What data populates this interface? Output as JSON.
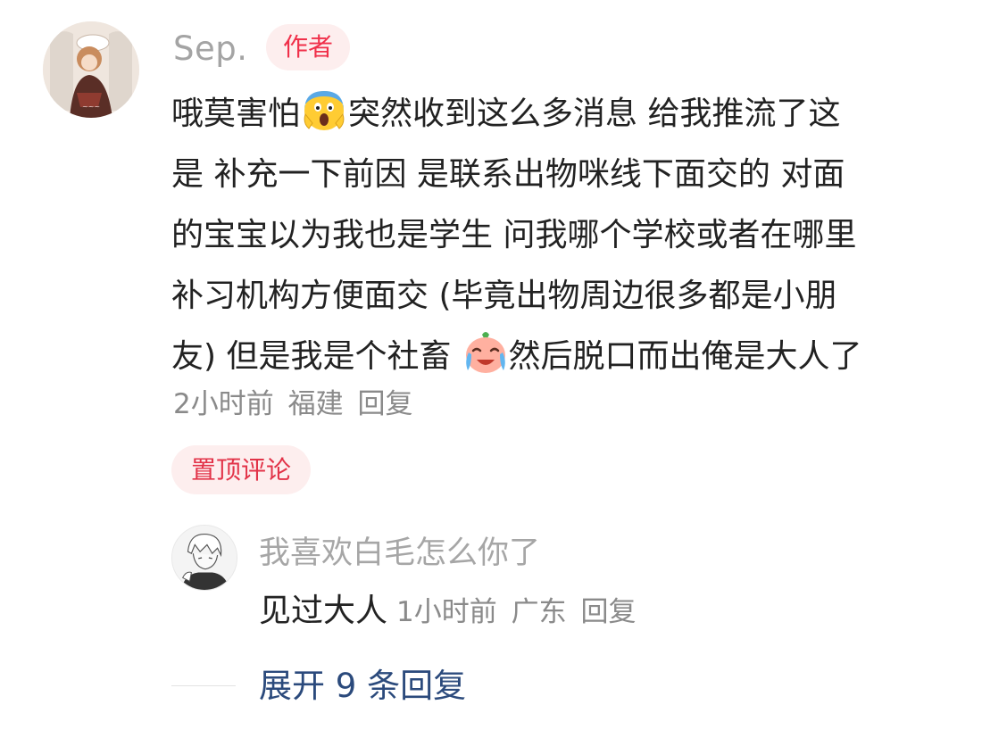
{
  "comment": {
    "author_name": "Sep.",
    "author_badge": "作者",
    "lines": [
      {
        "pre": "哦莫害怕",
        "post": "突然收到这么多消息 给我推流了这"
      },
      {
        "text": "是 补充一下前因 是联系出物咪线下面交的 对面"
      },
      {
        "text": "的宝宝以为我也是学生 问我哪个学校或者在哪里"
      },
      {
        "text": "补习机构方便面交 (毕竟出物周边很多都是小朋"
      },
      {
        "pre": "友) 但是我是个社畜",
        "post": "然后脱口而出俺是大人了"
      }
    ],
    "emoji_1": "scream-emoji-icon",
    "emoji_2": "crying-face-emoji-icon",
    "time": "2小时前",
    "location": "福建",
    "reply_label": "回复",
    "pinned_label": "置顶评论"
  },
  "reply": {
    "username": "我喜欢白毛怎么你了",
    "text": "见过大人",
    "time": "1小时前",
    "location": "广东",
    "reply_label": "回复"
  },
  "expand": {
    "label": "展开 9 条回复"
  },
  "colors": {
    "accent_red": "#f0304a",
    "badge_bg": "#fdeeee",
    "link_blue": "#2b4a7c",
    "muted_gray": "#8a8a8a"
  }
}
